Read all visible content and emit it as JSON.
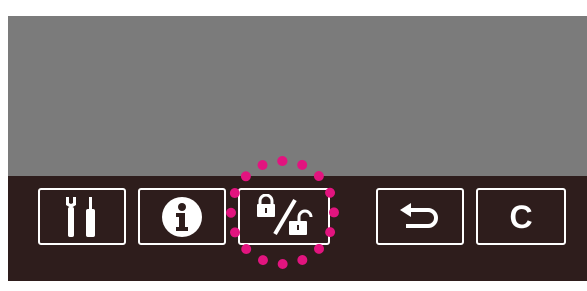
{
  "toolbar": {
    "buttons": [
      {
        "name": "tools-button",
        "icon": "wrench-screwdriver-icon"
      },
      {
        "name": "info-button",
        "icon": "info-icon"
      },
      {
        "name": "lock-unlock-button",
        "icon": "lock-unlock-icon",
        "highlighted": true
      },
      {
        "name": "return-button",
        "icon": "return-arrow-icon"
      },
      {
        "name": "clear-button",
        "icon": "clear-icon",
        "label": "C"
      }
    ]
  },
  "colors": {
    "screen": "#7b7b7b",
    "toolbar": "#2e1d1c",
    "button_border": "#ffffff",
    "highlight": "#e2147f"
  }
}
